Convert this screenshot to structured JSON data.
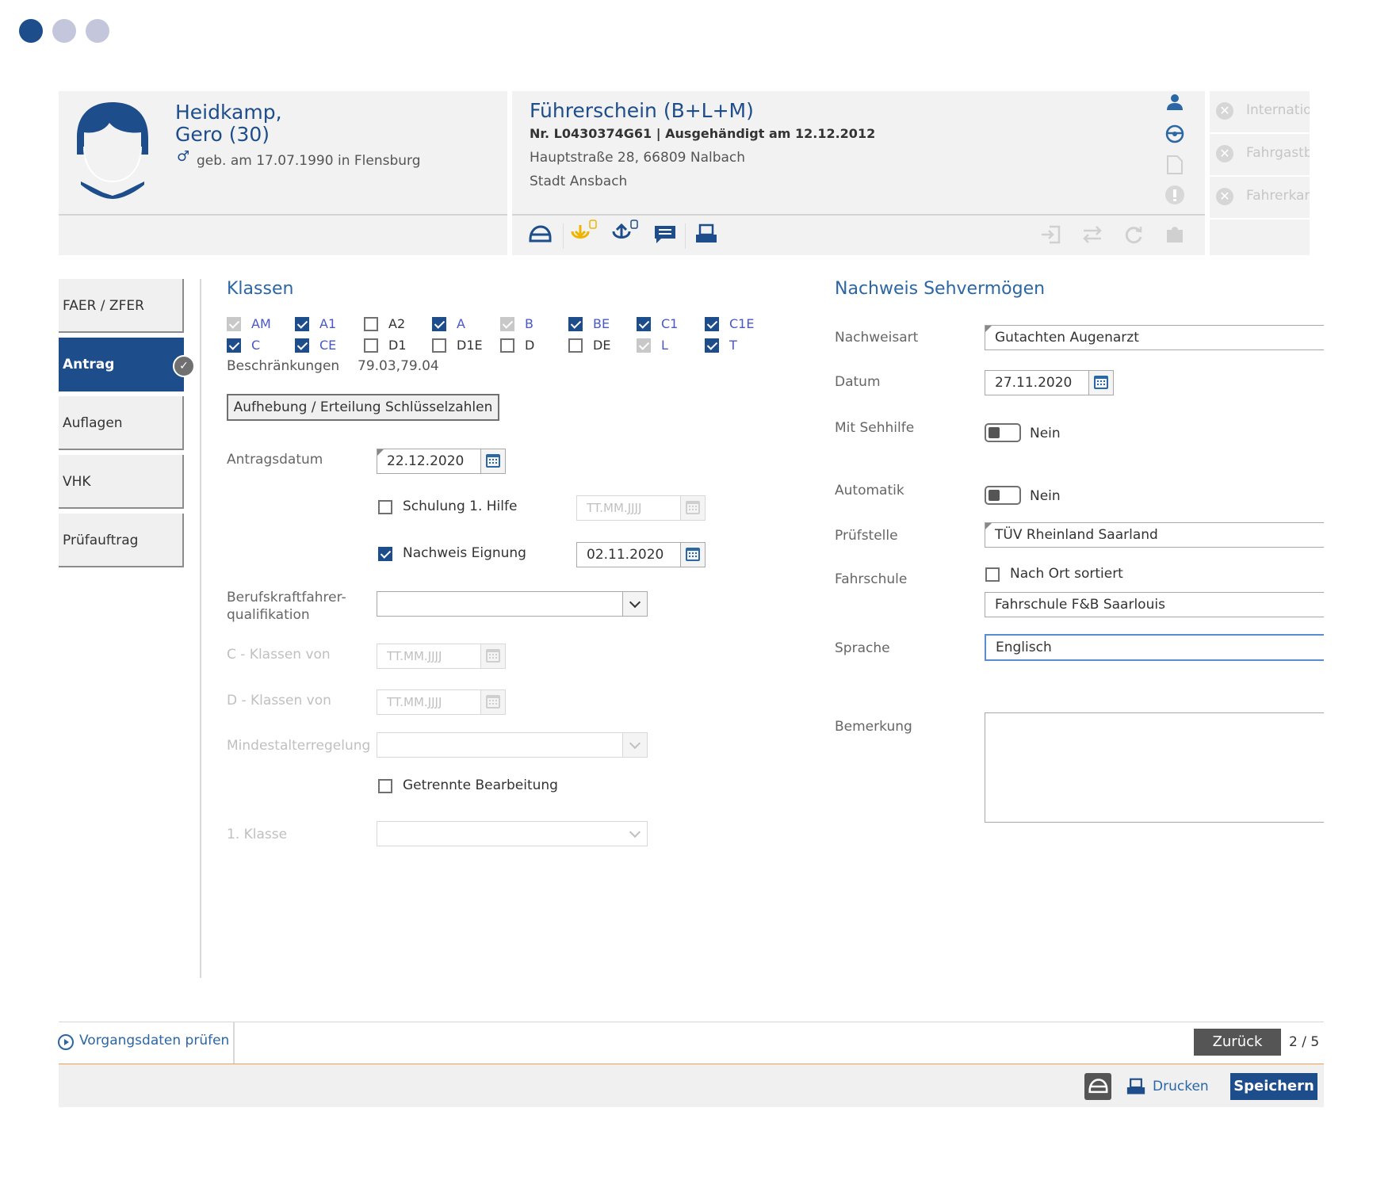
{
  "steps": {
    "total": 3,
    "current": 1
  },
  "person": {
    "last_name": "Heidkamp,",
    "first_name_age": "Gero (30)",
    "gender_symbol": "♂",
    "birth_info": "geb. am 17.07.1990 in Flensburg"
  },
  "license": {
    "title": "Führerschein (B+L+M)",
    "number_line": "Nr. L0430374G61 | Ausgehändigt am 12.12.2012",
    "address": "Hauptstraße 28, 66809 Nalbach",
    "authority": "Stadt Ansbach"
  },
  "side_actions": [
    "Internationale",
    "Fahrgastbefö",
    "Fahrerkarte"
  ],
  "toolbar_icons": [
    "helmet-icon",
    "download-badge-icon",
    "upload-badge-icon",
    "message-icon",
    "print-icon"
  ],
  "toolbar_icons_right": [
    "login-icon",
    "transfer-icon",
    "refresh-icon",
    "puzzle-icon"
  ],
  "nav": {
    "items": [
      "FAER / ZFER",
      "Antrag",
      "Auflagen",
      "VHK",
      "Prüfauftrag"
    ],
    "active": "Antrag"
  },
  "klassen": {
    "title": "Klassen",
    "row1": [
      {
        "label": "AM",
        "state": "disabled"
      },
      {
        "label": "A1",
        "state": "checked"
      },
      {
        "label": "A2",
        "state": "unchecked"
      },
      {
        "label": "A",
        "state": "checked"
      },
      {
        "label": "B",
        "state": "disabled"
      },
      {
        "label": "BE",
        "state": "checked"
      },
      {
        "label": "C1",
        "state": "checked"
      },
      {
        "label": "C1E",
        "state": "checked"
      }
    ],
    "row2": [
      {
        "label": "C",
        "state": "checked"
      },
      {
        "label": "CE",
        "state": "checked"
      },
      {
        "label": "D1",
        "state": "unchecked"
      },
      {
        "label": "D1E",
        "state": "unchecked"
      },
      {
        "label": "D",
        "state": "unchecked"
      },
      {
        "label": "DE",
        "state": "unchecked"
      },
      {
        "label": "L",
        "state": "disabled"
      },
      {
        "label": "T",
        "state": "checked"
      }
    ],
    "beschraenkungen_label": "Beschränkungen",
    "beschraenkungen_value": "79.03,79.04",
    "schluessel_button": "Aufhebung / Erteilung Schlüsselzahlen"
  },
  "form": {
    "antragsdatum_label": "Antragsdatum",
    "antragsdatum_value": "22.12.2020",
    "schulung_label": "Schulung 1. Hilfe",
    "schulung_checked": false,
    "schulung_placeholder": "TT.MM.JJJJ",
    "eignung_label": "Nachweis Eignung",
    "eignung_checked": true,
    "eignung_value": "02.11.2020",
    "bkf_label_1": "Berufskraftfahrer-",
    "bkf_label_2": "qualifikation",
    "c_klassen_label": "C - Klassen von",
    "c_klassen_placeholder": "TT.MM.JJJJ",
    "d_klassen_label": "D - Klassen von",
    "d_klassen_placeholder": "TT.MM.JJJJ",
    "mindestalter_label": "Mindestalterregelung",
    "getrennte_label": "Getrennte Bearbeitung",
    "getrennte_checked": false,
    "erste_klasse_label": "1. Klasse"
  },
  "sehvermoegen": {
    "title": "Nachweis Sehvermögen",
    "nachweisart_label": "Nachweisart",
    "nachweisart_value": "Gutachten Augenarzt",
    "datum_label": "Datum",
    "datum_value": "27.11.2020",
    "sehhilfe_label": "Mit Sehhilfe",
    "sehhilfe_value": "Nein",
    "automatik_label": "Automatik",
    "automatik_value": "Nein",
    "pruefstelle_label": "Prüfstelle",
    "pruefstelle_value": "TÜV Rheinland Saarland",
    "fahrschule_label": "Fahrschule",
    "nach_ort_label": "Nach Ort sortiert",
    "fahrschule_value": "Fahrschule F&B Saarlouis",
    "sprache_label": "Sprache",
    "sprache_value": "Englisch",
    "bemerkung_label": "Bemerkung",
    "bemerkung_value": ""
  },
  "footer": {
    "pruefen_label": "Vorgangsdaten prüfen",
    "zurueck_label": "Zurück",
    "page_indicator": "2 / 5",
    "drucken_label": "Drucken",
    "speichern_label": "Speichern"
  },
  "colors": {
    "navy": "#1e4d8c",
    "link_blue": "#2b66a5",
    "accent_orange": "#f0a050",
    "header_bg": "#f2f2f2",
    "icon_yellow": "#f0b400"
  }
}
